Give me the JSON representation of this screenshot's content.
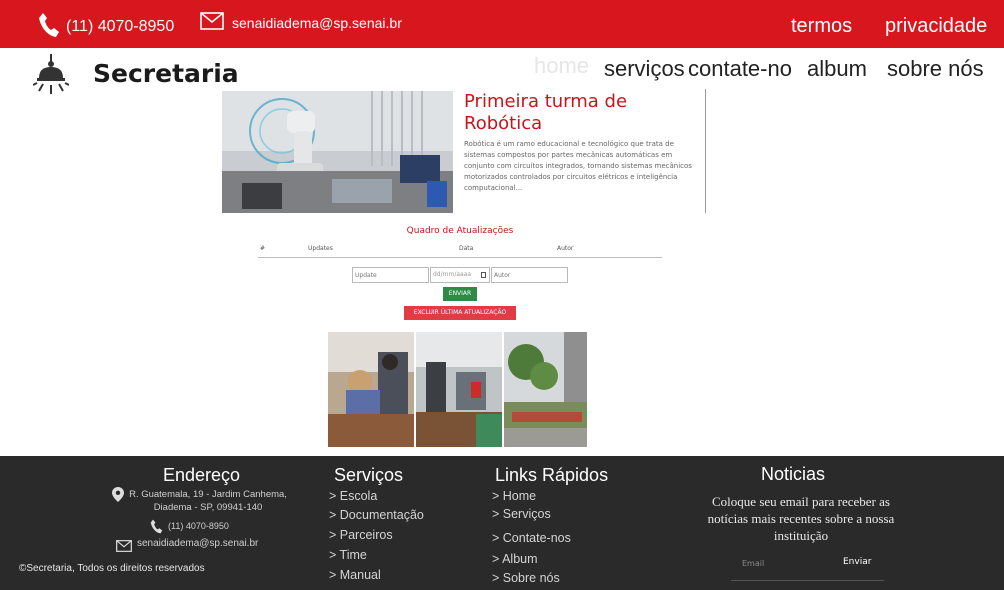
{
  "topbar": {
    "phone": "(11) 4070-8950",
    "email": "senaidiadema@sp.senai.br",
    "links": [
      "termos",
      "privacidade"
    ]
  },
  "header": {
    "brand": "Secretaria",
    "nav": [
      "home",
      "serviços",
      "contate-no",
      "album",
      "sobre nós"
    ]
  },
  "featured": {
    "title": "Primeira turma de Robótica",
    "text": "Robótica é um ramo educacional e tecnológico que trata de sistemas compostos por partes mecânicas automáticas em conjunto com circuitos integrados, tornando sistemas mecânicos motorizados controlados por circuitos elétricos e inteligência computacional..."
  },
  "updates": {
    "title": "Quadro de Atualizações",
    "columns": [
      "#",
      "Updates",
      "Data",
      "Autor"
    ],
    "update_placeholder": "Update",
    "date_placeholder": "dd/mm/aaaa",
    "author_placeholder": "Autor",
    "submit_label": "ENVIAR",
    "delete_label": "EXCLUIR ÚLTIMA ATUALIZAÇÃO"
  },
  "footer": {
    "address_title": "Endereço",
    "address": "R. Guatemala, 19 - Jardim Canhema, Diadema - SP, 09941-140",
    "phone": "(11) 4070-8950",
    "email": "senaidiadema@sp.senai.br",
    "services_title": "Serviços",
    "services": [
      "> Escola",
      "> Documentação",
      "> Parceiros",
      "> Time",
      "> Manual"
    ],
    "quick_title": "Links Rápidos",
    "quick": [
      "> Home",
      "> Serviços",
      "> Contate-nos",
      "> Album",
      "> Sobre nós"
    ],
    "news_title": "Noticias",
    "news_text": "Coloque seu email para receber as notícias mais recentes sobre a nossa instituição",
    "email_placeholder": "Email",
    "send_label": "Enviar",
    "copyright": "©Secretaria, Todos os direitos reservados"
  },
  "colors": {
    "brand_red": "#d8161d",
    "footer_bg": "#2a2a2a",
    "submit_green": "#2e8b45",
    "delete_red": "#e23b44"
  }
}
